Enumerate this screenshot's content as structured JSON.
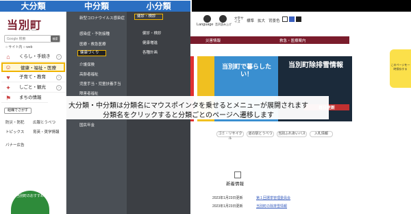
{
  "labels": {
    "large": "大分類",
    "medium": "中分類",
    "small": "小分類"
  },
  "site": {
    "logo": "当別町",
    "logo_sub": "Tobetsu Town",
    "search_placeholder": "Google 検索",
    "search_button": "検索",
    "search_scope": "○ サイト内  ○ web"
  },
  "categories": [
    {
      "label": "くらし・手続き",
      "icon": "house-icon"
    },
    {
      "label": "健康・福祉・医療",
      "icon": "people-icon"
    },
    {
      "label": "子育て・教育",
      "icon": "child-icon"
    },
    {
      "label": "しごと・観光",
      "icon": "briefcase-icon"
    },
    {
      "label": "まちの情報",
      "icon": "town-icon"
    }
  ],
  "sidebar_button": "組織でさがす",
  "side_links": [
    "防災・防犯",
    "トピックス",
    "バナー広告"
  ],
  "side_links_mid": [
    "広報とうべつ",
    "育英・奨学情報"
  ],
  "osusume": "当別町のおすすめ",
  "medium_items": [
    "新型コロナウイルス感染症",
    "感染症・予防接種",
    "医療・救急医療",
    "健康づくり",
    "介護保険",
    "高齢者福祉",
    "児童手当・児童扶養手当",
    "障害者福祉",
    "国民年金"
  ],
  "medium_active": "健康づくり",
  "small_items": [
    "健診・検診",
    "健康増進",
    "各種計画"
  ],
  "small_active": "健診・検診",
  "header": {
    "language": "Language",
    "voice": "音声読み上げ",
    "font_size": "文字サイズ",
    "standard": "標準",
    "enlarge": "拡大",
    "color": "背景色"
  },
  "nav": [
    "災害情報",
    "救急・医療案内"
  ],
  "banners": {
    "b1": "当別町で暮らしたい！",
    "b2": "当別町除排雪情報",
    "b2_sub": "毎日更新"
  },
  "tags": [
    "ゴミ・リサイクル",
    "道の駅とうべつ",
    "当別ふれあいバス",
    "入札情報"
  ],
  "news": {
    "title": "新着情報",
    "items": [
      {
        "date": "2023年1月23日更新",
        "link": "第１回選挙管理委員会"
      },
      {
        "date": "2023年1月23日更新",
        "link": "当別町の除排雪情報"
      }
    ]
  },
  "side_tab": "このページを一時保存する",
  "overlay": {
    "line1": "大分類・中分類は分類名にマウスポインタを乗せるとメニューが展開されます",
    "line2": "分類名をクリックすると分類ごとのページへ遷移します"
  }
}
